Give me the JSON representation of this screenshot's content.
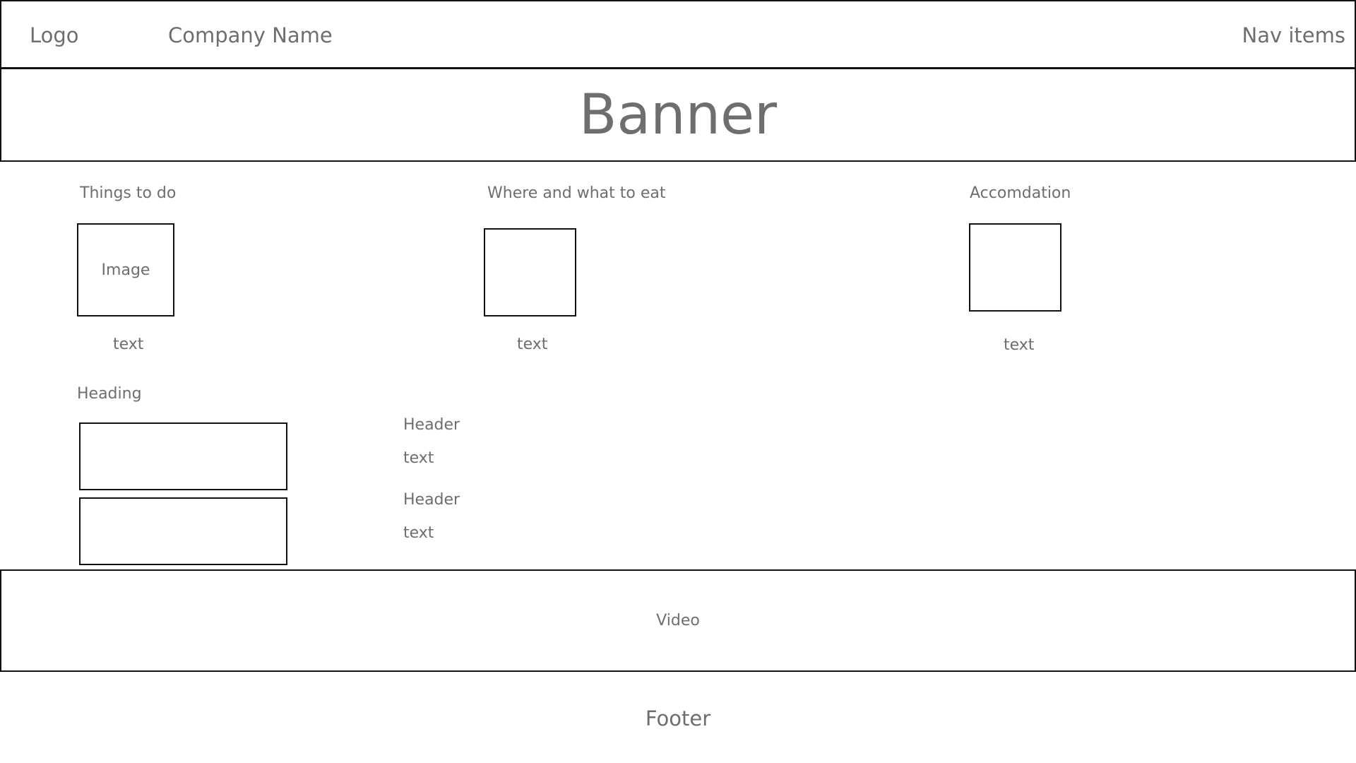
{
  "header": {
    "logo": "Logo",
    "company_name": "Company Name",
    "nav_items": "Nav items"
  },
  "banner": {
    "title": "Banner"
  },
  "sections": [
    {
      "title": "Things to do",
      "image_label": "Image",
      "text": "text"
    },
    {
      "title": "Where and what to eat",
      "image_label": "",
      "text": "text"
    },
    {
      "title": "Accomdation",
      "image_label": "",
      "text": "text"
    }
  ],
  "lower": {
    "heading": "Heading",
    "items": [
      {
        "header": "Header",
        "text": "text"
      },
      {
        "header": "Header",
        "text": "text"
      }
    ]
  },
  "video": {
    "label": "Video"
  },
  "footer": {
    "label": "Footer"
  }
}
